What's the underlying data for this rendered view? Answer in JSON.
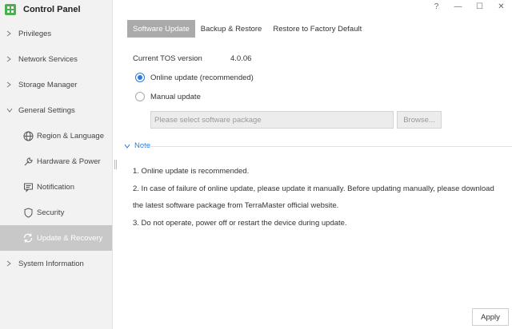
{
  "app": {
    "title": "Control Panel"
  },
  "window": {
    "help": "?",
    "minimize": "—",
    "maximize": "☐",
    "close": "✕"
  },
  "sidebar": {
    "items": [
      {
        "label": "Privileges"
      },
      {
        "label": "Network Services"
      },
      {
        "label": "Storage Manager"
      },
      {
        "label": "General Settings"
      },
      {
        "label": "System Information"
      }
    ],
    "sub_items": [
      {
        "label": "Region & Language",
        "icon": "globe-icon"
      },
      {
        "label": "Hardware & Power",
        "icon": "wrench-icon"
      },
      {
        "label": "Notification",
        "icon": "message-icon"
      },
      {
        "label": "Security",
        "icon": "shield-icon"
      },
      {
        "label": "Update & Recovery",
        "icon": "refresh-icon"
      }
    ]
  },
  "tabs": [
    {
      "label": "Software Update"
    },
    {
      "label": "Backup & Restore"
    },
    {
      "label": "Restore to Factory Default"
    }
  ],
  "update": {
    "version_label": "Current TOS version",
    "version_value": "4.0.06",
    "online_label": "Online update (recommended)",
    "manual_label": "Manual update",
    "package_placeholder": "Please select software package",
    "browse_label": "Browse..."
  },
  "note": {
    "title": "Note",
    "lines": [
      "1. Online update is recommended.",
      "2. In case of failure of online update, please update it manually. Before updating manually, please download the latest software package from TerraMaster official website.",
      "3. Do not operate, power off or restart the device during update."
    ]
  },
  "footer": {
    "apply_label": "Apply"
  },
  "colors": {
    "accent": "#2a7ae2",
    "sidebar_bg": "#f2f2f2",
    "active_bg": "#c8c8c8",
    "tab_active_bg": "#aaaaaa"
  }
}
